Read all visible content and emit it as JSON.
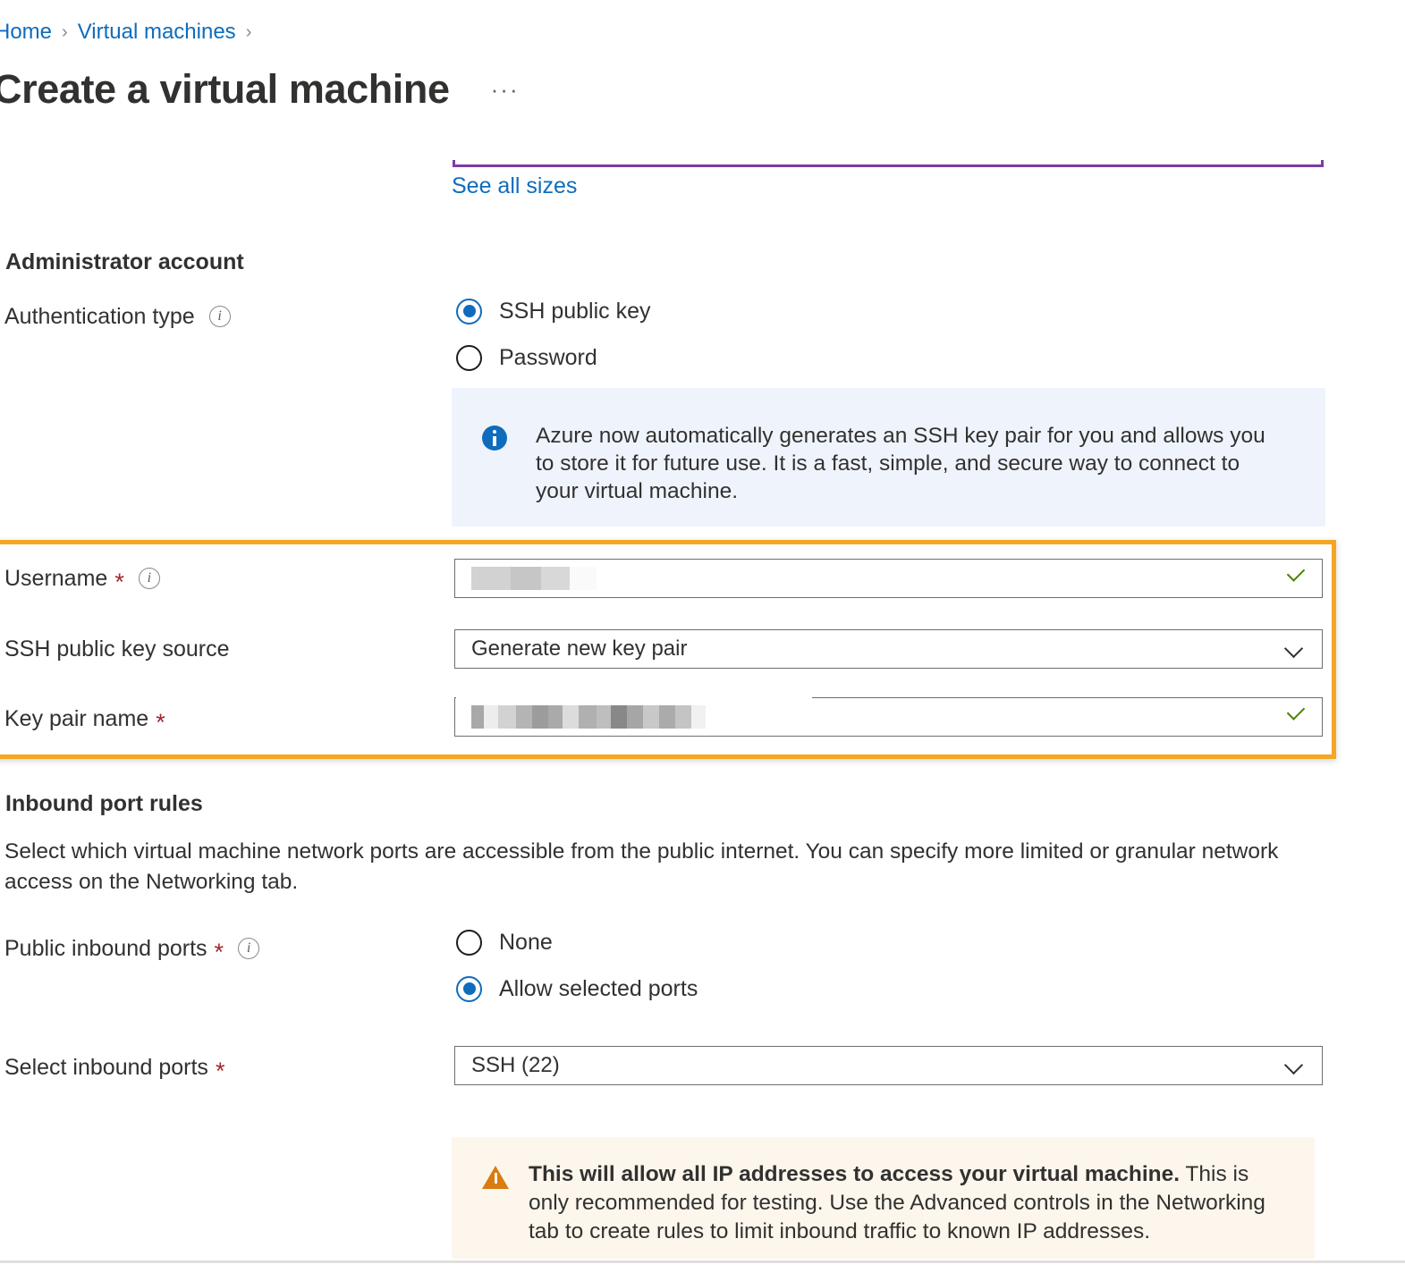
{
  "breadcrumb": {
    "items": [
      {
        "label": "Home"
      },
      {
        "label": "Virtual machines"
      }
    ],
    "separator": "›"
  },
  "header": {
    "title": "Create a virtual machine",
    "more_actions": "···"
  },
  "links": {
    "see_all_sizes": "See all sizes"
  },
  "sections": {
    "administrator_account": {
      "heading": "Administrator account",
      "authentication_type": {
        "label": "Authentication type",
        "info_icon": "info-icon",
        "options": [
          {
            "label": "SSH public key",
            "selected": true
          },
          {
            "label": "Password",
            "selected": false
          }
        ]
      },
      "info_callout": {
        "icon": "info-circle-icon",
        "text": "Azure now automatically generates an SSH key pair for you and allows you to store it for future use. It is a fast, simple, and secure way to connect to your virtual machine."
      },
      "username": {
        "label": "Username",
        "required_marker": "*",
        "info_icon": "info-icon",
        "value": "",
        "value_redacted": true,
        "placeholder": "",
        "validation_icon": "checkmark-icon"
      },
      "ssh_public_key_source": {
        "label": "SSH public key source",
        "value": "Generate new key pair",
        "chevron_icon": "chevron-down-icon"
      },
      "key_pair_name": {
        "label": "Key pair name",
        "required_marker": "*",
        "value": "",
        "value_redacted": true,
        "placeholder": "",
        "validation_icon": "checkmark-icon"
      }
    },
    "inbound_port_rules": {
      "heading": "Inbound port rules",
      "description": "Select which virtual machine network ports are accessible from the public internet. You can specify more limited or granular network access on the Networking tab.",
      "public_inbound_ports": {
        "label": "Public inbound ports",
        "required_marker": "*",
        "info_icon": "info-icon",
        "options": [
          {
            "label": "None",
            "selected": false
          },
          {
            "label": "Allow selected ports",
            "selected": true
          }
        ]
      },
      "select_inbound_ports": {
        "label": "Select inbound ports",
        "required_marker": "*",
        "value": "SSH (22)",
        "chevron_icon": "chevron-down-icon"
      },
      "warning_callout": {
        "icon": "warning-triangle-icon",
        "bold_text": "This will allow all IP addresses to access your virtual machine.",
        "rest_text": " This is only recommended for testing.  Use the Advanced controls in the Networking tab to create rules to limit inbound traffic to known IP addresses."
      }
    }
  },
  "colors": {
    "link": "#0f6cbd",
    "accent_purple": "#7a3ca3",
    "highlight_orange": "#f5a623",
    "required_red": "#a4262c",
    "validation_green": "#498205",
    "info_bg": "#eff4fc",
    "warning_bg": "#fdf6ec",
    "warning_icon": "#d97c11"
  }
}
